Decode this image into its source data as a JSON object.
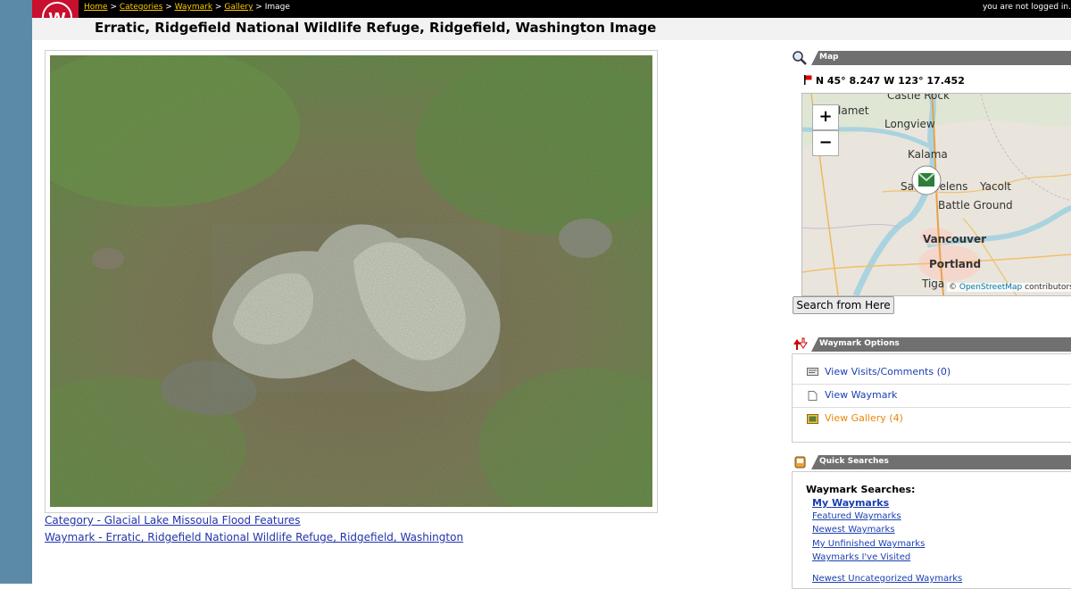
{
  "header": {
    "breadcrumbs": [
      {
        "label": "Home",
        "link": true
      },
      {
        "label": "Categories",
        "link": true
      },
      {
        "label": "Waymark",
        "link": true
      },
      {
        "label": "Gallery",
        "link": true
      },
      {
        "label": "Image",
        "link": false
      }
    ],
    "separator": ">",
    "login_status": "you are not logged in.",
    "page_title": "Erratic, Ridgefield National Wildlife Refuge, Ridgefield, Washington Image"
  },
  "main": {
    "image_subject": "rock erratic in grass",
    "links": {
      "category": "Category - Glacial Lake Missoula Flood Features",
      "waymark": "Waymark - Erratic, Ridgefield National Wildlife Refuge, Ridgefield, Washington"
    }
  },
  "sidebar": {
    "map": {
      "heading": "Map",
      "coordinates": "N 45° 8.247 W 123° 17.452",
      "zoom_in": "+",
      "zoom_out": "−",
      "places": [
        "Castle Rock",
        "lamet",
        "Longview",
        "Kalama",
        "Saint Helens",
        "Yacolt",
        "Battle Ground",
        "Vancouver",
        "Portland",
        "Tiga"
      ],
      "attribution_prefix": "©",
      "attribution_link": "OpenStreetMap",
      "attribution_suffix": "contributors",
      "search_button": "Search from Here"
    },
    "options": {
      "heading": "Waymark Options",
      "items": [
        {
          "label": "View Visits/Comments (0)",
          "icon": "comment-icon"
        },
        {
          "label": "View Waymark",
          "icon": "page-icon"
        },
        {
          "label": "View Gallery (4)",
          "icon": "gallery-icon"
        }
      ]
    },
    "quick_searches": {
      "heading": "Quick Searches",
      "subheading": "Waymark Searches:",
      "items": [
        "My Waymarks",
        "Featured Waymarks",
        "Newest Waymarks",
        "My Unfinished Waymarks",
        "Waymarks I've Visited",
        "Newest Uncategorized Waymarks"
      ]
    }
  },
  "colors": {
    "rail": "#5a8aa5",
    "brand_red": "#c8102e",
    "link_blue": "#1a3fb0",
    "crumb_yellow": "#ffcc00",
    "panel_gray": "#707070"
  }
}
